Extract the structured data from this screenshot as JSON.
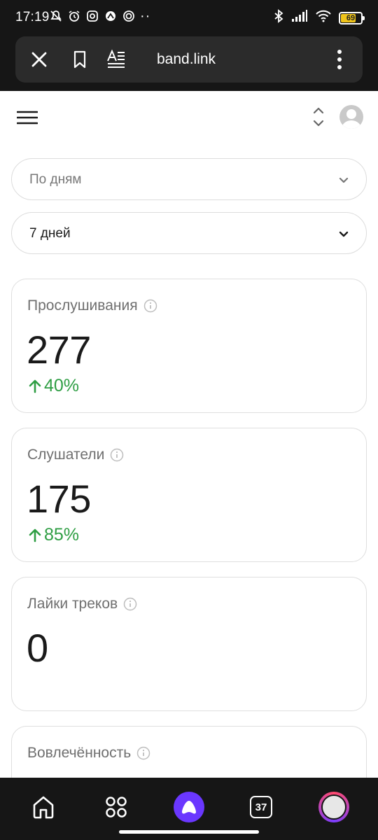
{
  "status_bar": {
    "time": "17:19",
    "more": "··",
    "battery_level": "69",
    "battery_fraction": 0.69,
    "icons": [
      "mute-icon",
      "alarm-icon",
      "instagram-icon",
      "sync-icon",
      "target-icon",
      "bluetooth-icon",
      "signal-icon",
      "wifi-icon",
      "battery-icon"
    ]
  },
  "browser": {
    "url": "band.link",
    "icons": [
      "close-icon",
      "bookmark-icon",
      "reader-icon",
      "more-vertical-icon"
    ]
  },
  "header": {
    "icons": [
      "menu-icon",
      "sort-icon",
      "avatar"
    ]
  },
  "filters": {
    "grouping": "По дням",
    "period": "7 дней"
  },
  "stats": [
    {
      "title": "Прослушивания",
      "value": "277",
      "delta": "40%",
      "trend": "up"
    },
    {
      "title": "Слушатели",
      "value": "175",
      "delta": "85%",
      "trend": "up"
    },
    {
      "title": "Лайки треков",
      "value": "0"
    },
    {
      "title": "Вовлечённость"
    }
  ],
  "bottom_nav": {
    "tabs_count": "37",
    "icons": [
      "home-icon",
      "apps-icon",
      "alice-icon",
      "tabs-icon",
      "profile-icon"
    ]
  },
  "colors": {
    "positive": "#2f9e44",
    "chrome_bg": "#161616",
    "addr_bg": "#2b2b2b",
    "alice": "#6a37ff",
    "battery": "#f0c419"
  }
}
